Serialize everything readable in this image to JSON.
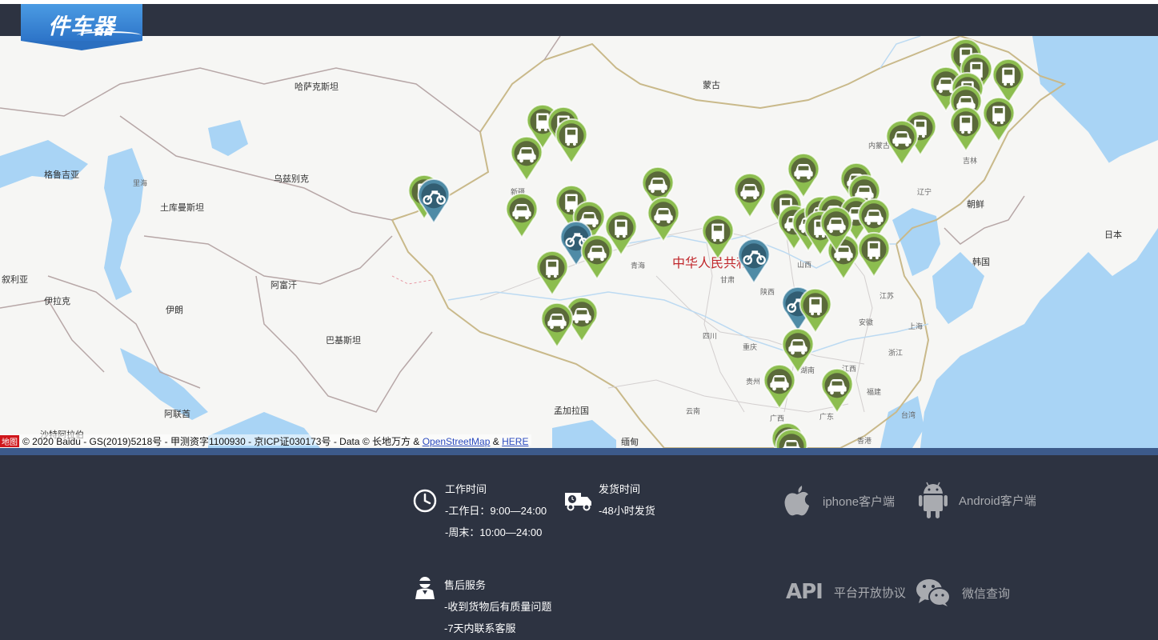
{
  "header": {
    "logo_text": "件车器"
  },
  "map": {
    "labels": [
      {
        "name": "kazakhstan",
        "text": "哈萨克斯坦"
      },
      {
        "name": "mongolia",
        "text": "蒙古"
      },
      {
        "name": "georgia",
        "text": "格鲁吉亚"
      },
      {
        "name": "caspian",
        "text": "里海"
      },
      {
        "name": "uzbekistan",
        "text": "乌兹别克"
      },
      {
        "name": "turkmenistan",
        "text": "土库曼斯坦"
      },
      {
        "name": "syria",
        "text": "叙利亚"
      },
      {
        "name": "iraq",
        "text": "伊拉克"
      },
      {
        "name": "iran",
        "text": "伊朗"
      },
      {
        "name": "afghanistan",
        "text": "阿富汗"
      },
      {
        "name": "pakistan",
        "text": "巴基斯坦"
      },
      {
        "name": "uae",
        "text": "阿联酋"
      },
      {
        "name": "saudi",
        "text": "沙特阿拉伯"
      },
      {
        "name": "bangladesh",
        "text": "孟加拉国"
      },
      {
        "name": "myanmar",
        "text": "缅甸"
      },
      {
        "name": "north-korea",
        "text": "朝鲜"
      },
      {
        "name": "south-korea",
        "text": "韩国"
      },
      {
        "name": "japan",
        "text": "日本"
      },
      {
        "name": "china",
        "text": "中华人民共和国"
      },
      {
        "name": "xinjiang",
        "text": "新疆"
      },
      {
        "name": "qinghai",
        "text": "青海"
      },
      {
        "name": "gansu",
        "text": "甘肃"
      },
      {
        "name": "shaanxi",
        "text": "陕西"
      },
      {
        "name": "shanxi",
        "text": "山西"
      },
      {
        "name": "sichuan",
        "text": "四川"
      },
      {
        "name": "chongqing",
        "text": "重庆"
      },
      {
        "name": "guizhou",
        "text": "贵州"
      },
      {
        "name": "yunnan",
        "text": "云南"
      },
      {
        "name": "guangxi",
        "text": "广西"
      },
      {
        "name": "guangdong",
        "text": "广东"
      },
      {
        "name": "hunan",
        "text": "湖南"
      },
      {
        "name": "jiangxi",
        "text": "江西"
      },
      {
        "name": "fujian",
        "text": "福建"
      },
      {
        "name": "zhejiang",
        "text": "浙江"
      },
      {
        "name": "anhui",
        "text": "安徽"
      },
      {
        "name": "jiangsu",
        "text": "江苏"
      },
      {
        "name": "shanghai",
        "text": "上海"
      },
      {
        "name": "taiwan",
        "text": "台湾"
      },
      {
        "name": "hongkong",
        "text": "香港"
      },
      {
        "name": "liaoning",
        "text": "辽宁"
      },
      {
        "name": "jilin",
        "text": "吉林"
      },
      {
        "name": "inner-mongolia",
        "text": "内蒙古"
      }
    ],
    "marker_colors": {
      "green": "#8cbd4f",
      "blue": "#4f8ba6",
      "icon": "#5b6a3a"
    },
    "copyright": {
      "logo": "地图",
      "text": "© 2020 Baidu - GS(2019)5218号 - 甲测资字1100930 - 京ICP证030173号 - Data © 长地万方 &",
      "link1": "OpenStreetMap",
      "amp": "&",
      "link2": "HERE"
    }
  },
  "footer": {
    "work_hours": {
      "title": "工作时间",
      "line1": "-工作日：9:00—24:00",
      "line2": "-周末：10:00—24:00",
      "icon": "clock-icon"
    },
    "shipping": {
      "title": "发货时间",
      "line1": "-48小时发货",
      "icon": "truck-icon"
    },
    "after_sales": {
      "title": "售后服务",
      "line1": "-收到货物后有质量问题",
      "line2": "-7天内联系客服",
      "icon": "support-agent-icon"
    },
    "apps": {
      "iphone": "iphone客户端",
      "android": "Android客户端",
      "api_logo": "API",
      "api": "平台开放协议",
      "wechat": "微信查询"
    }
  }
}
